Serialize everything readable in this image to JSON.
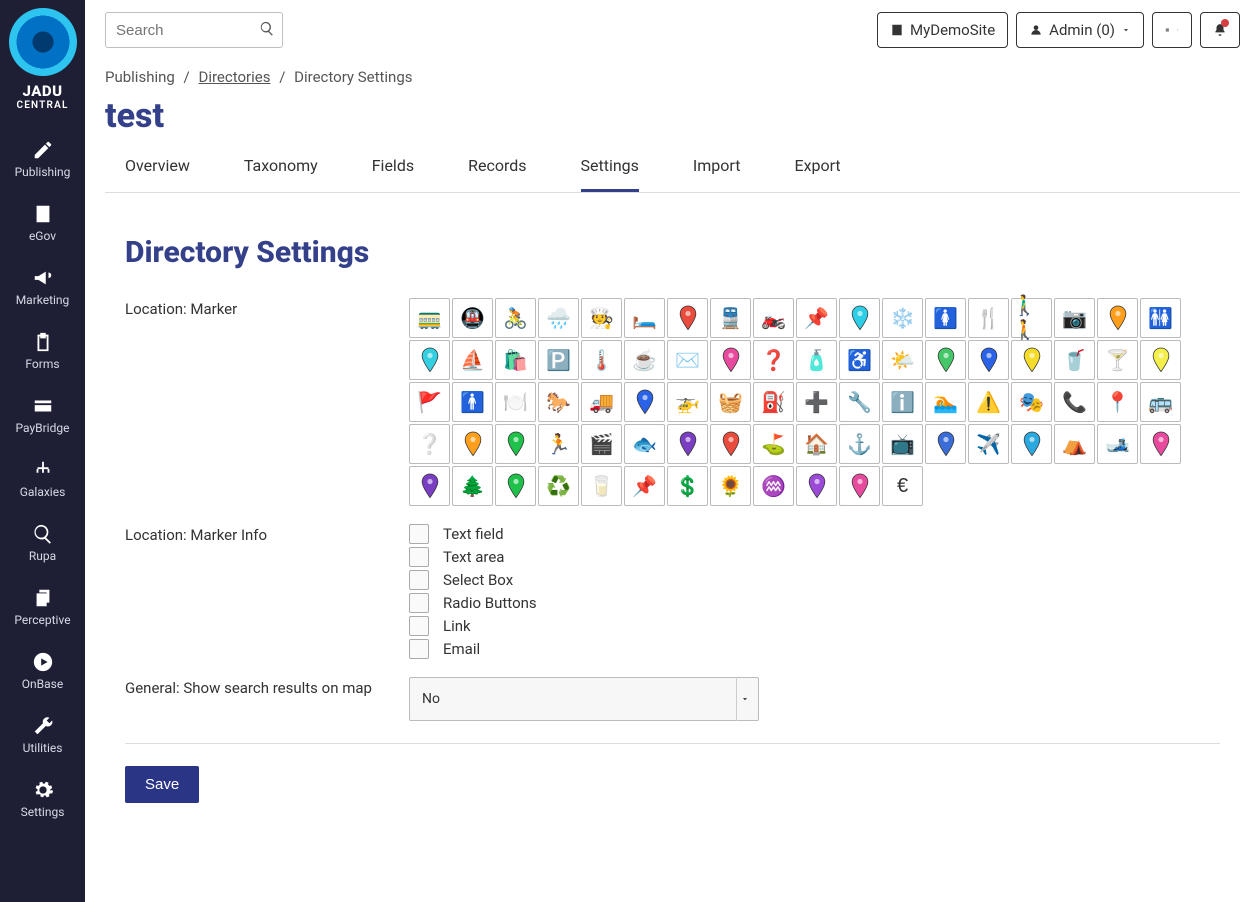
{
  "brand": {
    "name": "JADU",
    "sub": "CENTRAL"
  },
  "sidebar": [
    {
      "label": "Publishing",
      "icon": "pencil"
    },
    {
      "label": "eGov",
      "icon": "building"
    },
    {
      "label": "Marketing",
      "icon": "bullhorn"
    },
    {
      "label": "Forms",
      "icon": "clipboard"
    },
    {
      "label": "PayBridge",
      "icon": "card"
    },
    {
      "label": "Galaxies",
      "icon": "sitemap"
    },
    {
      "label": "Rupa",
      "icon": "search"
    },
    {
      "label": "Perceptive",
      "icon": "copy"
    },
    {
      "label": "OnBase",
      "icon": "circle-play"
    },
    {
      "label": "Utilities",
      "icon": "wrench"
    },
    {
      "label": "Settings",
      "icon": "gear"
    }
  ],
  "search": {
    "placeholder": "Search"
  },
  "header": {
    "site": "MyDemoSite",
    "user": "Admin (0)"
  },
  "crumbs": [
    "Publishing",
    "Directories",
    "Directory Settings"
  ],
  "page_title": "test",
  "tabs": [
    "Overview",
    "Taxonomy",
    "Fields",
    "Records",
    "Settings",
    "Import",
    "Export"
  ],
  "active_tab": "Settings",
  "panel_title": "Directory Settings",
  "form": {
    "marker_label": "Location: Marker",
    "marker_info_label": "Location: Marker Info",
    "marker_info_options": [
      "Text field",
      "Text area",
      "Select Box",
      "Radio Buttons",
      "Link",
      "Email"
    ],
    "search_results_label": "General: Show search results on map",
    "search_results_value": "No",
    "save": "Save"
  },
  "markers": [
    [
      "glyph",
      "🚃"
    ],
    [
      "glyph",
      "🚇"
    ],
    [
      "glyph",
      "🚴"
    ],
    [
      "glyph",
      "🌧️"
    ],
    [
      "glyph",
      "🧑‍🍳"
    ],
    [
      "glyph",
      "🛏️"
    ],
    [
      "pin",
      "#e94b3c"
    ],
    [
      "glyph",
      "🚆"
    ],
    [
      "glyph",
      "🏍️"
    ],
    [
      "glyph",
      "📌"
    ],
    [
      "pin",
      "#2ecfe6"
    ],
    [
      "glyph",
      "❄️"
    ],
    [
      "glyph",
      "🚺"
    ],
    [
      "glyph",
      "🍴"
    ],
    [
      "glyph",
      "🚶‍♂️🚶"
    ],
    [
      "glyph",
      "📷"
    ],
    [
      "pin",
      "#ff9f1c"
    ],
    [
      "glyph",
      "🚻"
    ],
    [
      "pin",
      "#34cfe0"
    ],
    [
      "glyph",
      "⛵"
    ],
    [
      "glyph",
      "🛍️"
    ],
    [
      "glyph",
      "🅿️"
    ],
    [
      "glyph",
      "🌡️"
    ],
    [
      "glyph",
      "☕"
    ],
    [
      "glyph",
      "✉️"
    ],
    [
      "pin",
      "#e84b9d"
    ],
    [
      "glyph",
      "❓"
    ],
    [
      "glyph",
      "🧴"
    ],
    [
      "glyph",
      "♿"
    ],
    [
      "glyph",
      "🌤️"
    ],
    [
      "pin",
      "#44c768"
    ],
    [
      "pin",
      "#2a63e8"
    ],
    [
      "pin",
      "#f6dc2a"
    ],
    [
      "glyph",
      "🥤"
    ],
    [
      "glyph",
      "🍸"
    ],
    [
      "pin",
      "#f4ef4a"
    ],
    [
      "glyph",
      "🚩"
    ],
    [
      "glyph",
      "🚹"
    ],
    [
      "glyph",
      "🍽️"
    ],
    [
      "glyph",
      "🐎"
    ],
    [
      "glyph",
      "🚚"
    ],
    [
      "pin",
      "#2a63e8"
    ],
    [
      "glyph",
      "🚁"
    ],
    [
      "glyph",
      "🧺"
    ],
    [
      "glyph",
      "⛽"
    ],
    [
      "glyph",
      "➕"
    ],
    [
      "glyph",
      "🔧"
    ],
    [
      "glyph",
      "ℹ️"
    ],
    [
      "glyph",
      "🏊"
    ],
    [
      "glyph",
      "⚠️"
    ],
    [
      "glyph",
      "🎭"
    ],
    [
      "glyph",
      "📞"
    ],
    [
      "glyph",
      "📍"
    ],
    [
      "glyph",
      "🚌"
    ],
    [
      "glyph",
      "❔"
    ],
    [
      "pin",
      "#ff9f1c"
    ],
    [
      "pin",
      "#1ec24a"
    ],
    [
      "glyph",
      "🏃"
    ],
    [
      "glyph",
      "🎬"
    ],
    [
      "glyph",
      "🐟"
    ],
    [
      "pin",
      "#7a3ec2"
    ],
    [
      "pin",
      "#e94b3c"
    ],
    [
      "glyph",
      "⛳"
    ],
    [
      "glyph",
      "🏠"
    ],
    [
      "glyph",
      "⚓"
    ],
    [
      "glyph",
      "📺"
    ],
    [
      "pin",
      "#3a6dd8"
    ],
    [
      "glyph",
      "✈️"
    ],
    [
      "pin",
      "#2aa8e0"
    ],
    [
      "glyph",
      "⛺"
    ],
    [
      "glyph",
      "🎿"
    ],
    [
      "pin",
      "#e84b9d"
    ],
    [
      "pin",
      "#7a3ec2"
    ],
    [
      "glyph",
      "🌲"
    ],
    [
      "pin",
      "#1ec24a"
    ],
    [
      "glyph",
      "♻️"
    ],
    [
      "glyph",
      "🥛"
    ],
    [
      "glyph",
      "📌"
    ],
    [
      "glyph",
      "💲"
    ],
    [
      "glyph",
      "🌻"
    ],
    [
      "glyph",
      "♒"
    ],
    [
      "pin",
      "#9b4bd8"
    ],
    [
      "pin",
      "#e84b9d"
    ],
    [
      "glyph",
      "€"
    ]
  ]
}
